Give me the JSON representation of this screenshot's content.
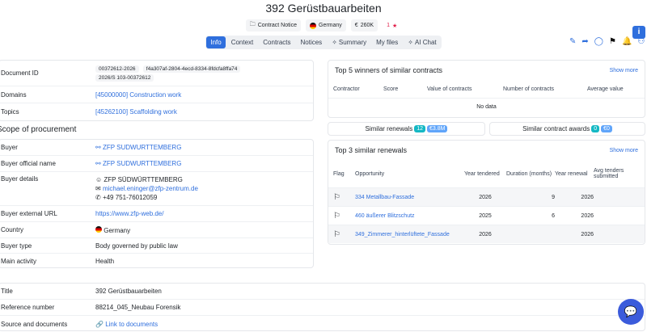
{
  "header": {
    "title": "392 Gerüstbauarbeiten",
    "doc_type": "Contract Notice",
    "country": "Germany",
    "value": "260K",
    "rating": "1"
  },
  "tabs": [
    {
      "label": "Info",
      "active": true
    },
    {
      "label": "Context"
    },
    {
      "label": "Contracts"
    },
    {
      "label": "Notices"
    },
    {
      "label": "Summary"
    },
    {
      "label": "My files"
    },
    {
      "label": "AI Chat"
    }
  ],
  "doc": {
    "rows": [
      {
        "label": "Document ID",
        "pills": [
          "00372612-2026",
          "f4a307af-2804-4ecd-8334-8fdcfa8ffa74",
          "2026/S 103-00372612"
        ]
      },
      {
        "label": "Domains",
        "value": "[45000000] Construction work"
      },
      {
        "label": "Topics",
        "value": "[45262100] Scaffolding work"
      }
    ]
  },
  "procurement": {
    "heading": "Scope of procurement",
    "buyer_label": "Buyer",
    "buyer_value": "ZFP SUDWURTTEMBERG",
    "official_label": "Buyer official name",
    "official_value": "ZFP SUDWURTTEMBERG",
    "details_label": "Buyer details",
    "details_name": "ZFP SÜDWÜRTTEMBERG",
    "details_email": "michael.eninger@zfp-zentrum.de",
    "details_phone": "+49 751-76012059",
    "url_label": "Buyer external URL",
    "url_value": "https://www.zfp-web.de/",
    "country_label": "Country",
    "country_value": "Germany",
    "type_label": "Buyer type",
    "type_value": "Body governed by public law",
    "activity_label": "Main activity",
    "activity_value": "Health"
  },
  "winners": {
    "heading": "Top 5 winners of similar contracts",
    "show_more": "Show more",
    "cols": [
      "Contractor",
      "Score",
      "Value of contracts",
      "Number of contracts",
      "Average value"
    ],
    "empty": "No data"
  },
  "similar": {
    "renewals_label": "Similar renewals",
    "renewals_count": "12",
    "renewals_value": "€3.8M",
    "awards_label": "Similar contract awards",
    "awards_count": "0",
    "awards_value": "€0"
  },
  "renewals": {
    "heading": "Top 3 similar renewals",
    "show_more": "Show more",
    "cols": [
      "Flag",
      "Opportunity",
      "Year tendered",
      "Duration (months)",
      "Year renewal",
      "Avg tenders submitted"
    ],
    "rows": [
      {
        "opportunity": "334 Metallbau-Fassade",
        "year": "2026",
        "duration": "9",
        "renewal": "2026"
      },
      {
        "opportunity": "460 äußerer Blitzschutz",
        "year": "2025",
        "duration": "6",
        "renewal": "2026"
      },
      {
        "opportunity": "349_Zimmerer_hinterlüftete_Fassade",
        "year": "2026",
        "duration": "",
        "renewal": "2026"
      }
    ]
  },
  "bottom": {
    "title_label": "Title",
    "title_value": "392 Gerüstbauarbeiten",
    "ref_label": "Reference number",
    "ref_value": "88214_045_Neubau Forensik",
    "source_label": "Source and documents",
    "source_value": "Link to documents"
  },
  "colors": {
    "accent": "#2f6fdd",
    "teal": "#14b8c4",
    "blue_badge": "#3b82f6"
  }
}
